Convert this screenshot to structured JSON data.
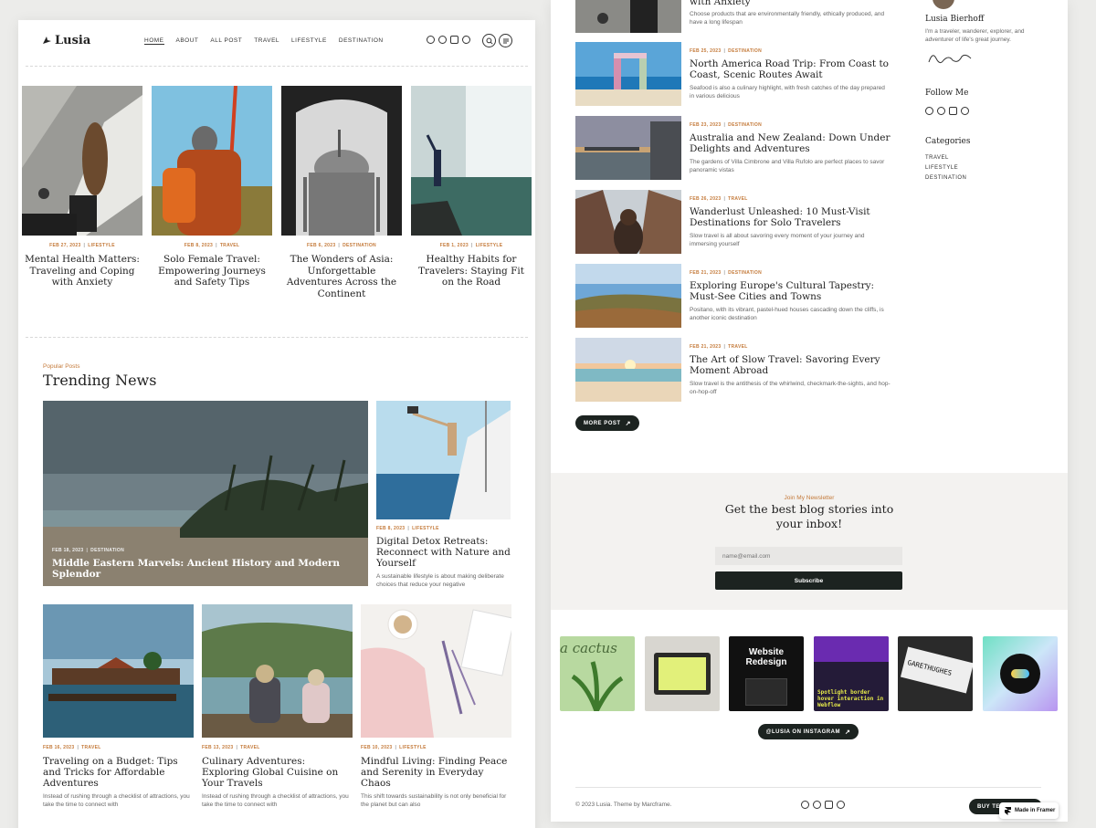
{
  "brand": {
    "logo_text": "Lusia"
  },
  "nav": {
    "items": [
      "HOME",
      "ABOUT",
      "ALL POST",
      "TRAVEL",
      "LIFESTYLE",
      "DESTINATION"
    ]
  },
  "top_cards": [
    {
      "meta_date": "FEB 27, 2023",
      "meta_cat": "LIFESTYLE",
      "title": "Mental Health Matters: Traveling and Coping with Anxiety"
    },
    {
      "meta_date": "FEB 8, 2023",
      "meta_cat": "TRAVEL",
      "title": "Solo Female Travel: Empowering Journeys and Safety Tips"
    },
    {
      "meta_date": "FEB 6, 2023",
      "meta_cat": "DESTINATION",
      "title": "The Wonders of Asia: Unforgettable Adventures Across the Continent"
    },
    {
      "meta_date": "FEB 1, 2023",
      "meta_cat": "LIFESTYLE",
      "title": "Healthy Habits for Travelers: Staying Fit on the Road"
    }
  ],
  "trending": {
    "kicker": "Popular Posts",
    "heading": "Trending News",
    "feature": {
      "meta_date": "FEB 18, 2023",
      "meta_cat": "DESTINATION",
      "title": "Middle Eastern Marvels: Ancient History and Modern Splendor"
    },
    "side": {
      "meta_date": "FEB 8, 2023",
      "meta_cat": "LIFESTYLE",
      "title": "Digital Detox Retreats: Reconnect with Nature and Yourself",
      "excerpt": "A sustainable lifestyle is about making deliberate choices that reduce your negative"
    },
    "bottom": [
      {
        "meta_date": "FEB 16, 2023",
        "meta_cat": "TRAVEL",
        "title": "Traveling on a Budget: Tips and Tricks for Affordable Adventures",
        "excerpt": "Instead of rushing through a checklist of attractions, you take the time to connect with"
      },
      {
        "meta_date": "FEB 13, 2023",
        "meta_cat": "TRAVEL",
        "title": "Culinary Adventures: Exploring Global Cuisine on Your Travels",
        "excerpt": "Instead of rushing through a checklist of attractions, you take the time to connect with"
      },
      {
        "meta_date": "FEB 10, 2023",
        "meta_cat": "LIFESTYLE",
        "title": "Mindful Living: Finding Peace and Serenity in Everyday Chaos",
        "excerpt": "This shift towards sustainability is not only beneficial for the planet but can also"
      }
    ]
  },
  "list_posts": {
    "first": {
      "title": "with Anxiety",
      "excerpt": "Choose products that are environmentally friendly, ethically produced, and have a long lifespan"
    },
    "items": [
      {
        "meta_date": "FEB 25, 2023",
        "meta_cat": "DESTINATION",
        "title": "North America Road Trip: From Coast to Coast, Scenic Routes Await",
        "excerpt": "Seafood is also a culinary highlight, with fresh catches of the day prepared in various delicious"
      },
      {
        "meta_date": "FEB 23, 2023",
        "meta_cat": "DESTINATION",
        "title": "Australia and New Zealand: Down Under Delights and Adventures",
        "excerpt": "The gardens of Villa Cimbrone and Villa Rufolo are perfect places to savor panoramic vistas"
      },
      {
        "meta_date": "FEB 26, 2023",
        "meta_cat": "TRAVEL",
        "title": "Wanderlust Unleashed: 10 Must-Visit Destinations for Solo Travelers",
        "excerpt": "Slow travel is all about savoring every moment of your journey and immersing yourself"
      },
      {
        "meta_date": "FEB 21, 2023",
        "meta_cat": "DESTINATION",
        "title": "Exploring Europe's Cultural Tapestry: Must-See Cities and Towns",
        "excerpt": "Positano, with its vibrant, pastel-hued houses cascading down the cliffs, is another iconic destination"
      },
      {
        "meta_date": "FEB 21, 2023",
        "meta_cat": "TRAVEL",
        "title": "The Art of Slow Travel: Savoring Every Moment Abroad",
        "excerpt": "Slow travel is the antithesis of the whirlwind, checkmark-the-sights, and hop-on-hop-off"
      }
    ],
    "more_label": "MORE POST"
  },
  "sidebar": {
    "author_name": "Lusia Bierhoff",
    "author_bio": "I'm a traveler, wanderer, explorer, and adventurer of life's great journey.",
    "follow_heading": "Follow Me",
    "categories_heading": "Categories",
    "categories": [
      "TRAVEL",
      "LIFESTYLE",
      "DESTINATION"
    ]
  },
  "newsletter": {
    "kicker": "Join My Newsletter",
    "heading_line1": "Get the best blog stories into",
    "heading_line2": "your inbox!",
    "placeholder": "name@email.com",
    "button": "Subscribe"
  },
  "instagram": {
    "tiles": [
      "a cactus",
      "",
      "Website Redesign",
      "Spotlight border hover interaction in Webflow",
      "GARETHUGHES",
      ""
    ],
    "button": "@LUSIA ON INSTAGRAM"
  },
  "footer": {
    "copyright": "© 2023 Lusia. Theme by Marcframe.",
    "buy_label": "BUY TE",
    "framer_badge": "Made in Framer"
  },
  "colors": {
    "accent": "#c47a3a",
    "dark": "#1c2320",
    "panel": "#ffffff",
    "background": "#ececea",
    "newsletter_bg": "#f3f2f0"
  },
  "icons": [
    "facebook-icon",
    "twitter-icon",
    "instagram-icon",
    "pinterest-icon",
    "search-icon",
    "menu-icon",
    "arrow-up-right-icon",
    "framer-icon"
  ]
}
